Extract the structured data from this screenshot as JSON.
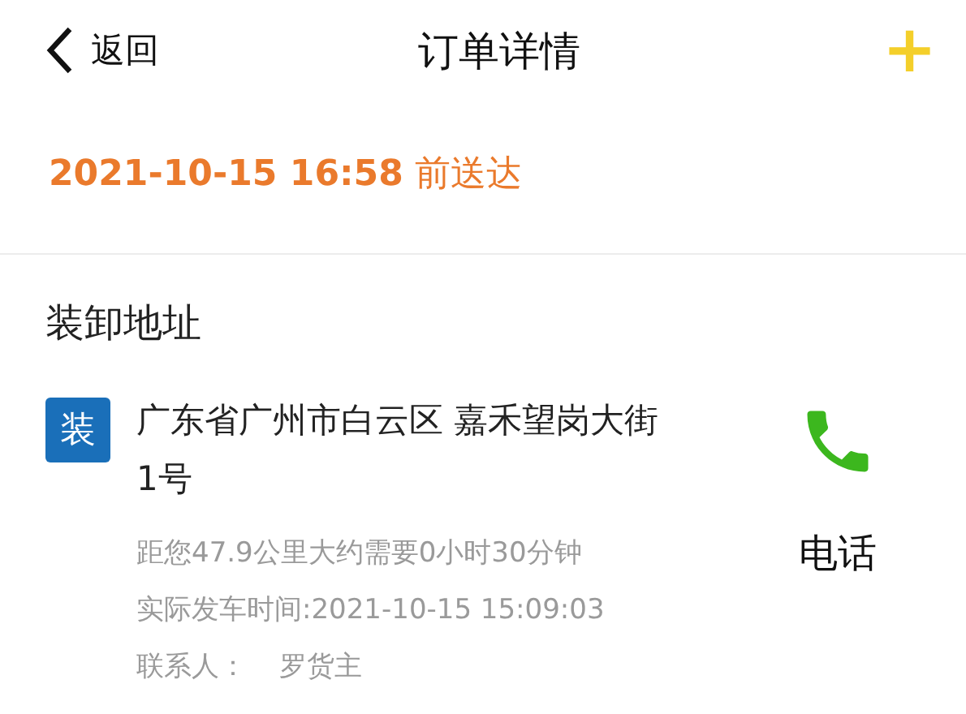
{
  "header": {
    "back_label": "返回",
    "title": "订单详情",
    "add_icon": "+"
  },
  "delivery_deadline": {
    "time": "2021-10-15 16:58",
    "suffix": "前送达"
  },
  "section_title": "装卸地址",
  "address": {
    "badge": "装",
    "text": "广东省广州市白云区 嘉禾望岗大街1号",
    "distance": "距您47.9公里大约需要0小时30分钟",
    "departure": "实际发车时间:2021-10-15 15:09:03",
    "contact_label": "联系人：",
    "contact_name": "罗货主",
    "call_label": "电话"
  }
}
